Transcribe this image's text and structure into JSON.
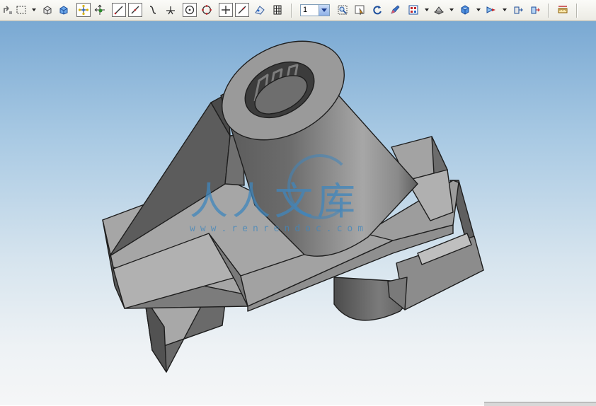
{
  "toolbar": {
    "zoom_value": "1",
    "icons": [
      "rotate-icon",
      "select-box-icon",
      "view-box-icon",
      "solid-box-icon",
      "snap-icon",
      "move-icon",
      "line-icon",
      "diagonal-icon",
      "curve-icon",
      "perpendicular-icon",
      "circle-target-icon",
      "circle-point-icon",
      "cross-icon",
      "slash-icon",
      "sketch-icon",
      "grid-icon",
      "zoom-fit-icon",
      "zoom-window-icon",
      "refresh-icon",
      "pencil-icon",
      "view-select-icon",
      "render-mode-icon",
      "shaded-cube-icon",
      "view-arrow-icon",
      "section-icon",
      "section-two-icon",
      "measure-icon"
    ]
  },
  "watermark": {
    "chinese": "人人文库",
    "url": "www.renrendoc.com"
  },
  "colors": {
    "accent": "#3f86bd",
    "part_top": "#a6a6a6",
    "part_side": "#6a6a6a",
    "part_dark": "#4a4a4a"
  }
}
